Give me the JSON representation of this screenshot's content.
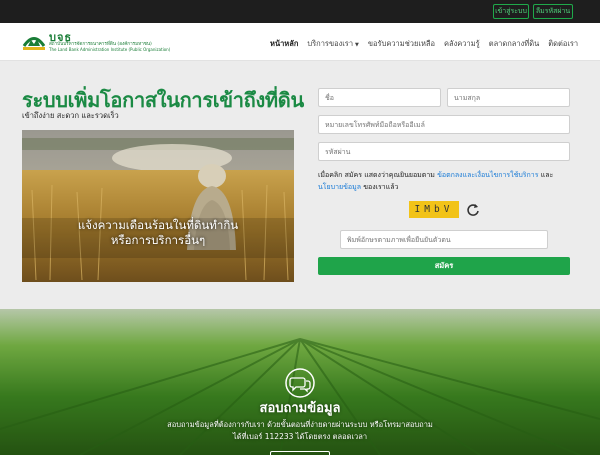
{
  "topbar": {
    "login_label": "เข้าสู่ระบบ",
    "register_label": "ลืมรหัสผ่าน"
  },
  "brand": {
    "name": "บจธ",
    "thai_name": "สถาบันบริหารจัดการธนาคารที่ดิน (องค์การมหาชน)",
    "english_name": "The Land Bank Administration Institute (Public Organization)",
    "color": "#1a7d37"
  },
  "nav": {
    "items": [
      {
        "label": "หน้าหลัก"
      },
      {
        "label": "บริการของเรา",
        "has_dropdown": true
      },
      {
        "label": "ขอรับความช่วยเหลือ"
      },
      {
        "label": "คลังความรู้"
      },
      {
        "label": "ตลาดกลางที่ดิน"
      },
      {
        "label": "ติดต่อเรา"
      }
    ]
  },
  "hero": {
    "headline": "ระบบเพิ่มโอกาสในการเข้าถึงที่ดิน",
    "subline": "เข้าถึงง่าย สะดวก และรวดเร็ว",
    "caption_line1": "แจ้งความเดือนร้อนในที่ดินทำกิน",
    "caption_line2": "หรือการบริการอื่นๆ"
  },
  "form": {
    "first_name_placeholder": "ชื่อ",
    "last_name_placeholder": "นามสกุล",
    "phone_email_placeholder": "หมายเลขโทรศัพท์มือถือหรืออีเมล์",
    "password_placeholder": "รหัสผ่าน",
    "consent_prefix": "เมื่อคลิก สมัคร แสดงว่าคุณยินยอมตาม ",
    "consent_terms_link": "ข้อตกลงและเงื่อนไขการใช้บริการ",
    "consent_and": " และ ",
    "consent_policy_link": "นโยบายข้อมูล",
    "consent_suffix": " ของเราแล้ว",
    "captcha_text": "IMbV",
    "captcha_placeholder": "พิมพ์อักษรตามภาพเพื่อยืนยันตัวตน",
    "submit_label": "สมัคร",
    "accent_color": "#1fa44a",
    "link_color": "#1a7bd6"
  },
  "inquiry": {
    "title": "สอบถามข้อมูล",
    "description_line1": "สอบถามข้อมูลที่ต้องการกับเรา ด้วยขั้นตอนที่ง่ายดายผ่านระบบ หรือโทรมาสอบถาม",
    "description_line2": "ได้ที่เบอร์ 112233 ได้โดยตรง ตลอดเวลา",
    "icon": "chat-bubbles-icon"
  }
}
